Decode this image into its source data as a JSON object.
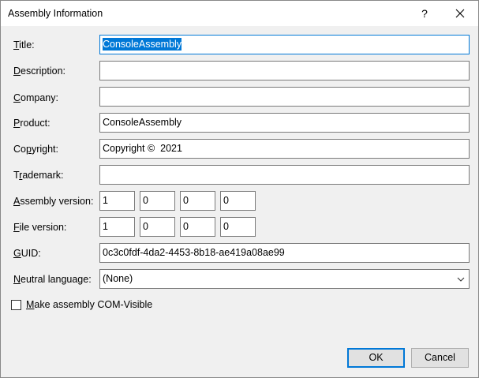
{
  "window": {
    "title": "Assembly Information",
    "help_label": "?",
    "close_icon": "close-icon"
  },
  "fields": {
    "title": {
      "label_prefix": "",
      "label_access": "T",
      "label_rest": "itle:",
      "value": "ConsoleAssembly"
    },
    "description": {
      "label_prefix": "",
      "label_access": "D",
      "label_rest": "escription:",
      "value": ""
    },
    "company": {
      "label_prefix": "",
      "label_access": "C",
      "label_rest": "ompany:",
      "value": ""
    },
    "product": {
      "label_prefix": "",
      "label_access": "P",
      "label_rest": "roduct:",
      "value": "ConsoleAssembly"
    },
    "copyright": {
      "label_prefix": "Co",
      "label_access": "p",
      "label_rest": "yright:",
      "value": "Copyright ©  2021"
    },
    "trademark": {
      "label_prefix": "T",
      "label_access": "r",
      "label_rest": "ademark:",
      "value": ""
    },
    "assembly_version": {
      "label_prefix": "",
      "label_access": "A",
      "label_rest": "ssembly version:",
      "values": [
        "1",
        "0",
        "0",
        "0"
      ]
    },
    "file_version": {
      "label_prefix": "",
      "label_access": "F",
      "label_rest": "ile version:",
      "values": [
        "1",
        "0",
        "0",
        "0"
      ]
    },
    "guid": {
      "label_prefix": "",
      "label_access": "G",
      "label_rest": "UID:",
      "value": "0c3c0fdf-4da2-4453-8b18-ae419a08ae99"
    },
    "neutral_language": {
      "label_prefix": "",
      "label_access": "N",
      "label_rest": "eutral language:",
      "value": "(None)"
    }
  },
  "com_visible": {
    "label_access": "M",
    "label_rest": "ake assembly COM-Visible",
    "checked": false
  },
  "buttons": {
    "ok": "OK",
    "cancel": "Cancel"
  },
  "colors": {
    "accent": "#0078d7",
    "background": "#f0f0f0"
  }
}
